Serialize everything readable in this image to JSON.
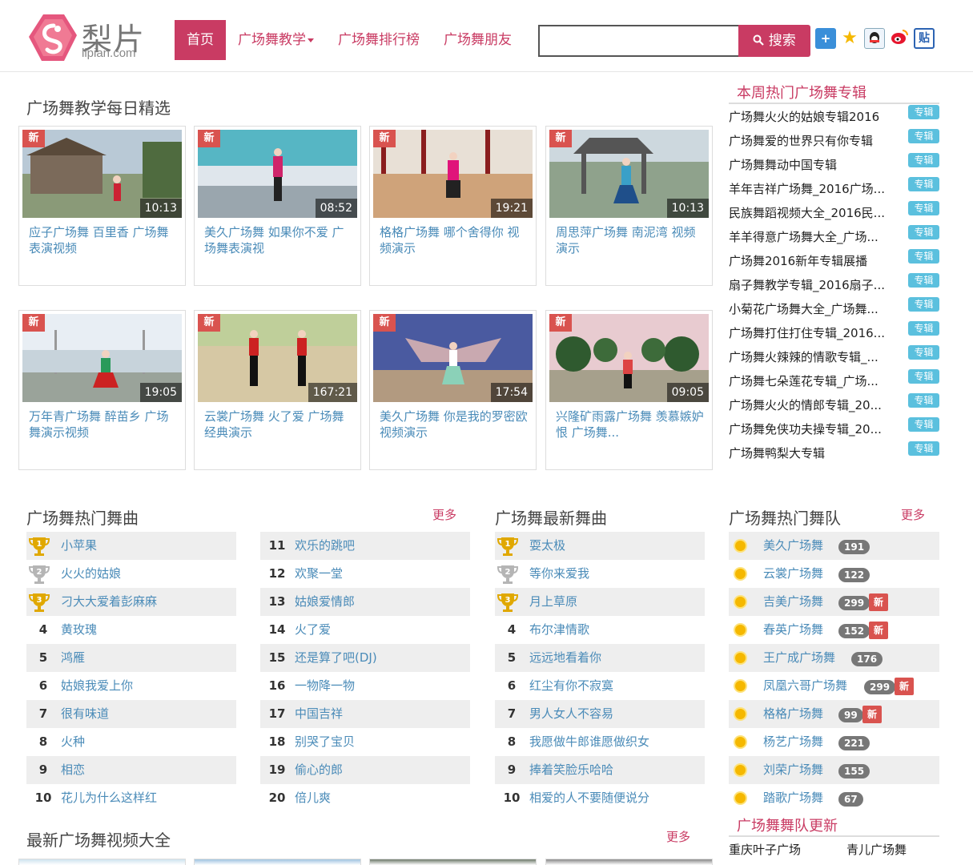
{
  "site": {
    "logo_main": "梨片",
    "logo_sub": "lipian.com"
  },
  "nav": {
    "items": [
      {
        "label": "首页",
        "active": true
      },
      {
        "label": "广场舞教学",
        "dropdown": true
      },
      {
        "label": "广场舞排行榜"
      },
      {
        "label": "广场舞朋友"
      }
    ]
  },
  "search": {
    "button_label": "搜索",
    "value": "",
    "placeholder": ""
  },
  "share_icons": [
    "add-icon",
    "qzone-star-icon",
    "qq-icon",
    "weibo-icon",
    "tieba-icon"
  ],
  "daily": {
    "title": "广场舞教学每日精选",
    "badge": "新",
    "videos": [
      {
        "title": "应子广场舞 百里香 广场舞表演视频",
        "duration": "10:13"
      },
      {
        "title": "美久广场舞 如果你不爱 广场舞表演视",
        "duration": "08:52"
      },
      {
        "title": "格格广场舞 哪个舍得你 视频演示",
        "duration": "19:21"
      },
      {
        "title": "周思萍广场舞 南泥湾 视频演示",
        "duration": "10:13"
      },
      {
        "title": "万年青广场舞 醉苗乡 广场舞演示视频",
        "duration": "19:05"
      },
      {
        "title": "云裳广场舞 火了爱 广场舞经典演示",
        "duration": "167:21"
      },
      {
        "title": "美久广场舞 你是我的罗密欧 视频演示",
        "duration": "17:54"
      },
      {
        "title": "兴隆矿雨露广场舞 羡慕嫉妒恨 广场舞...",
        "duration": "09:05"
      }
    ]
  },
  "albums": {
    "title": "本周热门广场舞专辑",
    "tag": "专辑",
    "items": [
      "广场舞火火的姑娘专辑2016",
      "广场舞爱的世界只有你专辑",
      "广场舞舞动中国专辑",
      "羊年吉祥广场舞_2016广场...",
      "民族舞蹈视频大全_2016民...",
      "羊羊得意广场舞大全_广场...",
      "广场舞2016新年专辑展播",
      "扇子舞教学专辑_2016扇子...",
      "小菊花广场舞大全_广场舞...",
      "广场舞打住打住专辑_2016...",
      "广场舞火辣辣的情歌专辑_...",
      "广场舞七朵莲花专辑_广场...",
      "广场舞火火的情郎专辑_20...",
      "广场舞免侠功夫操专辑_20...",
      "广场舞鸭梨大专辑"
    ]
  },
  "hot_songs": {
    "title": "广场舞热门舞曲",
    "more": "更多",
    "col1": [
      {
        "rank": "1",
        "name": "小苹果"
      },
      {
        "rank": "2",
        "name": "火火的姑娘"
      },
      {
        "rank": "3",
        "name": "刁大大爱着彭麻麻"
      },
      {
        "rank": "4",
        "name": "黄玫瑰"
      },
      {
        "rank": "5",
        "name": "鸿雁"
      },
      {
        "rank": "6",
        "name": "姑娘我爱上你"
      },
      {
        "rank": "7",
        "name": "很有味道"
      },
      {
        "rank": "8",
        "name": "火种"
      },
      {
        "rank": "9",
        "name": "相恋"
      },
      {
        "rank": "10",
        "name": "花儿为什么这样红"
      }
    ],
    "col2": [
      {
        "rank": "11",
        "name": "欢乐的跳吧"
      },
      {
        "rank": "12",
        "name": "欢聚一堂"
      },
      {
        "rank": "13",
        "name": "姑娘爱情郎"
      },
      {
        "rank": "14",
        "name": "火了爱"
      },
      {
        "rank": "15",
        "name": "还是算了吧(DJ)"
      },
      {
        "rank": "16",
        "name": "一物降一物"
      },
      {
        "rank": "17",
        "name": "中国吉祥"
      },
      {
        "rank": "18",
        "name": "别哭了宝贝"
      },
      {
        "rank": "19",
        "name": "偷心的郎"
      },
      {
        "rank": "20",
        "name": "倍儿爽"
      }
    ]
  },
  "new_songs": {
    "title": "广场舞最新舞曲",
    "items": [
      {
        "rank": "1",
        "name": "耍太极"
      },
      {
        "rank": "2",
        "name": "等你来爱我"
      },
      {
        "rank": "3",
        "name": "月上草原"
      },
      {
        "rank": "4",
        "name": "布尔津情歌"
      },
      {
        "rank": "5",
        "name": "远远地看着你"
      },
      {
        "rank": "6",
        "name": "红尘有你不寂寞"
      },
      {
        "rank": "7",
        "name": "男人女人不容易"
      },
      {
        "rank": "8",
        "name": "我愿做牛郎谁愿做织女"
      },
      {
        "rank": "9",
        "name": "捧着笑脸乐哈哈"
      },
      {
        "rank": "10",
        "name": "相爱的人不要随便说分"
      }
    ]
  },
  "teams": {
    "title": "广场舞热门舞队",
    "more": "更多",
    "new_label": "新",
    "items": [
      {
        "name": "美久广场舞",
        "count": "191",
        "new": false
      },
      {
        "name": "云裳广场舞",
        "count": "122",
        "new": false
      },
      {
        "name": "吉美广场舞",
        "count": "299",
        "new": true
      },
      {
        "name": "春英广场舞",
        "count": "152",
        "new": true
      },
      {
        "name": "王广成广场舞",
        "count": "176",
        "new": false
      },
      {
        "name": "凤凰六哥广场舞",
        "count": "299",
        "new": true
      },
      {
        "name": "格格广场舞",
        "count": "99",
        "new": true
      },
      {
        "name": "杨艺广场舞",
        "count": "221",
        "new": false
      },
      {
        "name": "刘荣广场舞",
        "count": "155",
        "new": false
      },
      {
        "name": "踏歌广场舞",
        "count": "67",
        "new": false
      }
    ]
  },
  "team_updates": {
    "title": "广场舞舞队更新",
    "items": [
      "重庆叶子广场",
      "青儿广场舞"
    ]
  },
  "latest": {
    "title": "最新广场舞视频大全",
    "more": "更多"
  },
  "colors": {
    "brand": "#c93b63",
    "link": "#4a8bb8",
    "new_badge": "#d9534f",
    "album_tag": "#5bc0de",
    "gold": "#e0a800",
    "silver": "#b5b5b5"
  }
}
